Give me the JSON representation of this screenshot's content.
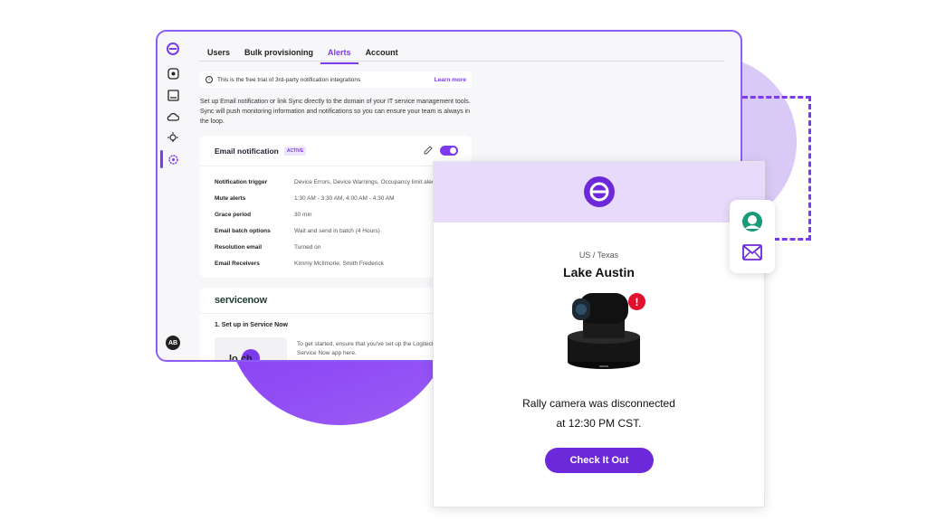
{
  "colors": {
    "accent": "#7c3aed",
    "accent_dark": "#6d28d9",
    "lavender": "#e8dafb",
    "alert": "#e0102f"
  },
  "app": {
    "sidebar_icons": [
      "logo-icon",
      "devices-icon",
      "inventory-icon",
      "cloud-icon",
      "insights-icon",
      "settings-icon"
    ],
    "avatar_initials": "AB",
    "tabs": [
      {
        "label": "Users",
        "active": false
      },
      {
        "label": "Bulk provisioning",
        "active": false
      },
      {
        "label": "Alerts",
        "active": true
      },
      {
        "label": "Account",
        "active": false
      }
    ],
    "banner": {
      "text": "This is the free trial of 3rd-party notification integrations",
      "link": "Learn more"
    },
    "intro": "Set up Email notification or link Sync directly to the domain of your IT service management tools. Sync will push monitoring information and notifications so you can ensure your team is always in the loop.",
    "email_card": {
      "title": "Email notification",
      "badge": "ACTIVE",
      "toggle_on": true,
      "settings": [
        {
          "key": "Notification trigger",
          "value": "Device Errors, Device Warnings, Occupancy limit alert"
        },
        {
          "key": "Mute alerts",
          "value": "1:30 AM - 3:30 AM, 4:00 AM - 4:30 AM"
        },
        {
          "key": "Grace period",
          "value": "30 min"
        },
        {
          "key": "Email batch options",
          "value": "Wait and send in batch (4 Hours)"
        },
        {
          "key": "Resolution email",
          "value": "Turned on"
        },
        {
          "key": "Email Receivers",
          "value": "Kimmy McIlmorie, Smith Frederick"
        }
      ]
    },
    "servicenow_card": {
      "logo": "servicenow",
      "step": "1. Set up in Service Now",
      "thumb_text": "lo    ch",
      "description": "To get started, ensure that you've set up the Logitech Sync Service Now app here."
    }
  },
  "notification": {
    "location": "US / Texas",
    "room": "Lake Austin",
    "alert_symbol": "!",
    "message_line1": "Rally camera was disconnected",
    "message_line2": "at 12:30 PM CST.",
    "cta": "Check It Out"
  }
}
